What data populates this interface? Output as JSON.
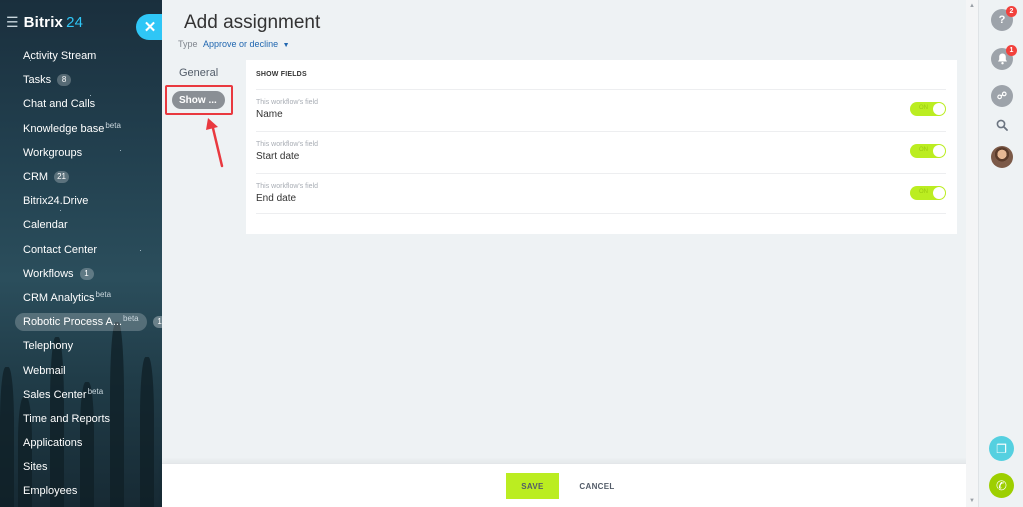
{
  "sidebar": {
    "logo_name": "Bitrix",
    "logo_number": "24",
    "items": [
      {
        "label": "Activity Stream"
      },
      {
        "label": "Tasks",
        "count": "8"
      },
      {
        "label": "Chat and Calls"
      },
      {
        "label": "Knowledge base",
        "sup": "beta"
      },
      {
        "label": "Workgroups"
      },
      {
        "label": "CRM",
        "count": "21"
      },
      {
        "label": "Bitrix24.Drive"
      },
      {
        "label": "Calendar"
      },
      {
        "label": "Contact Center"
      },
      {
        "label": "Workflows",
        "count": "1"
      },
      {
        "label": "CRM Analytics",
        "sup": "beta"
      },
      {
        "label": "Robotic Process A...",
        "sup": "beta",
        "count": "1",
        "active": true
      },
      {
        "label": "Telephony"
      },
      {
        "label": "Webmail"
      },
      {
        "label": "Sales Center",
        "sup": "beta"
      },
      {
        "label": "Time and Reports"
      },
      {
        "label": "Applications"
      },
      {
        "label": "Sites"
      },
      {
        "label": "Employees"
      }
    ]
  },
  "panel": {
    "title": "Add assignment",
    "type_label": "Type",
    "type_value": "Approve or decline",
    "tabs": {
      "general": "General",
      "show": "Show ..."
    },
    "section_heading": "SHOW FIELDS",
    "fields": [
      {
        "caption": "This workflow's field",
        "name": "Name",
        "toggle": "ON"
      },
      {
        "caption": "This workflow's field",
        "name": "Start date",
        "toggle": "ON"
      },
      {
        "caption": "This workflow's field",
        "name": "End date",
        "toggle": "ON"
      }
    ],
    "footer": {
      "save": "SAVE",
      "cancel": "CANCEL"
    }
  },
  "rightbar": {
    "help_badge": "2",
    "notifications_badge": "1"
  },
  "colors": {
    "accent_cyan": "#2fc6f6",
    "toggle_green": "#bbed21",
    "highlight_red": "#e9393f"
  }
}
